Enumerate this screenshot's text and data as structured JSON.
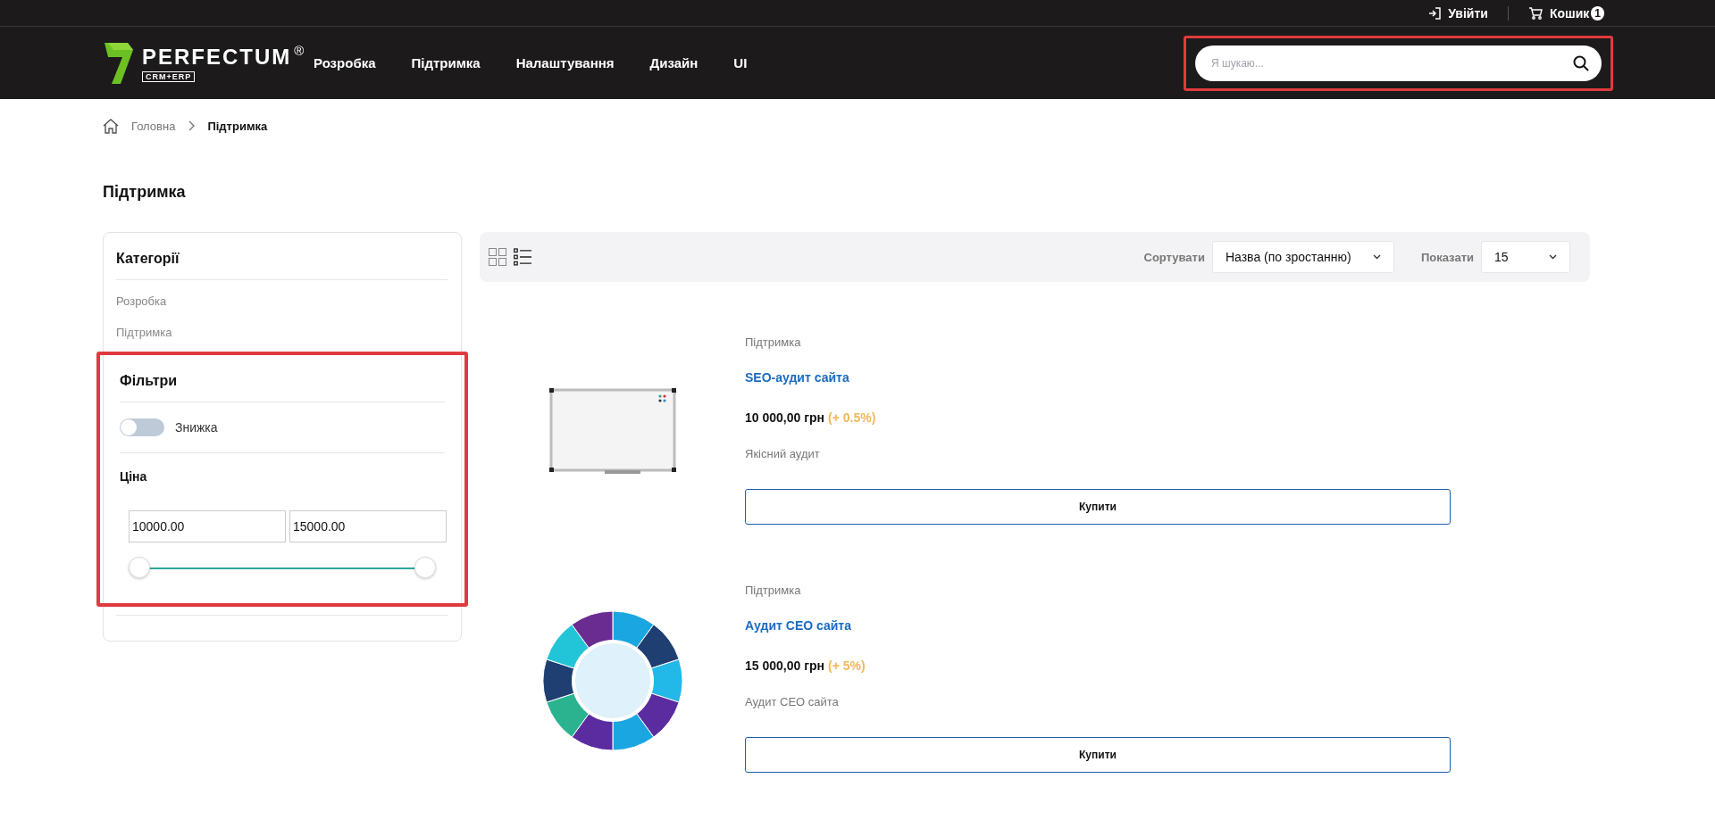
{
  "top_bar": {
    "login": "Увійти",
    "cart": "Кошик",
    "cart_count": "1"
  },
  "header": {
    "logo": {
      "name": "PERFECTUM",
      "mark": "®",
      "tagline": "CRM+ERP"
    },
    "nav": [
      "Розробка",
      "Підтримка",
      "Налаштування",
      "Дизайн",
      "UI"
    ],
    "search": {
      "placeholder": "Я шукаю...",
      "highlighted": true
    }
  },
  "breadcrumb": [
    {
      "label": "Головна",
      "current": false
    },
    {
      "label": "Підтримка",
      "current": true
    }
  ],
  "page_title": "Підтримка",
  "sidebar": {
    "categories_title": "Категорії",
    "categories": [
      "Розробка",
      "Підтримка"
    ],
    "filters": {
      "title": "Фільтри",
      "highlighted": true,
      "discount": {
        "label": "Знижка",
        "on": false
      },
      "price": {
        "title": "Ціна",
        "min": "10000.00",
        "max": "15000.00",
        "thumbs": [
          {
            "level": 0
          },
          {
            "level": 1
          }
        ]
      }
    }
  },
  "toolbar": {
    "views": [
      {
        "kind": "grid",
        "selected": false
      },
      {
        "kind": "list",
        "selected": true
      }
    ],
    "sort_label": "Сортувати",
    "sort_value": "Назва (по зростанню)",
    "show_label": "Показати",
    "show_value": "15"
  },
  "products": [
    {
      "kind": "whiteboard",
      "category": "Підтримка",
      "name": "SEO-аудит сайта",
      "price": "10 000,00 грн",
      "bonus": "(+ 0.5%)",
      "description": "Якісний аудит",
      "button": "Купити"
    },
    {
      "kind": "wheel",
      "category": "Підтримка",
      "name": "Аудит СЕО сайта",
      "price": "15 000,00 грн",
      "bonus": "(+ 5%)",
      "description": "Аудит СЕО сайта",
      "button": "Купити"
    }
  ]
}
